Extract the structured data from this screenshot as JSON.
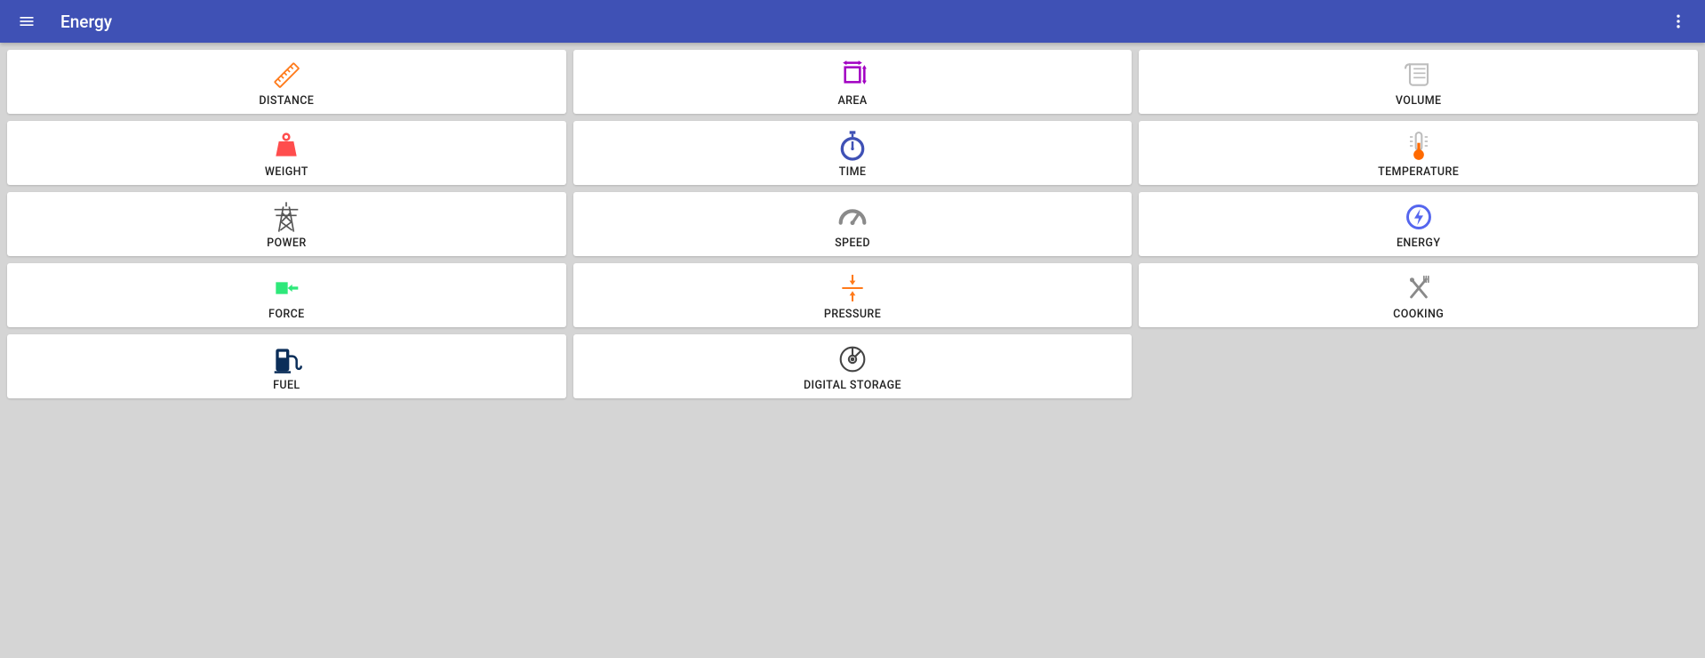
{
  "header": {
    "title": "Energy"
  },
  "categories": [
    {
      "id": "distance",
      "label": "DISTANCE",
      "icon": "ruler",
      "color": "#ff7a1a"
    },
    {
      "id": "area",
      "label": "AREA",
      "icon": "area",
      "color": "#a100c2"
    },
    {
      "id": "volume",
      "label": "VOLUME",
      "icon": "cup",
      "color": "#bdbdbd"
    },
    {
      "id": "weight",
      "label": "WEIGHT",
      "icon": "weight",
      "color": "#ff4d4d"
    },
    {
      "id": "time",
      "label": "TIME",
      "icon": "stopwatch",
      "color": "#3f51b5"
    },
    {
      "id": "temperature",
      "label": "TEMPERATURE",
      "icon": "thermometer",
      "color": "#ff6a00"
    },
    {
      "id": "power",
      "label": "POWER",
      "icon": "pylon",
      "color": "#555555"
    },
    {
      "id": "speed",
      "label": "SPEED",
      "icon": "gauge",
      "color": "#8a8a8a"
    },
    {
      "id": "energy",
      "label": "ENERGY",
      "icon": "bolt",
      "color": "#5566ee"
    },
    {
      "id": "force",
      "label": "FORCE",
      "icon": "force",
      "color": "#2ee87a"
    },
    {
      "id": "pressure",
      "label": "PRESSURE",
      "icon": "pressure",
      "color": "#ff7a1a"
    },
    {
      "id": "cooking",
      "label": "COOKING",
      "icon": "utensils",
      "color": "#8a8a8a"
    },
    {
      "id": "fuel",
      "label": "FUEL",
      "icon": "pump",
      "color": "#0b2e59"
    },
    {
      "id": "digital-storage",
      "label": "DIGITAL STORAGE",
      "icon": "disc",
      "color": "#444444"
    }
  ]
}
